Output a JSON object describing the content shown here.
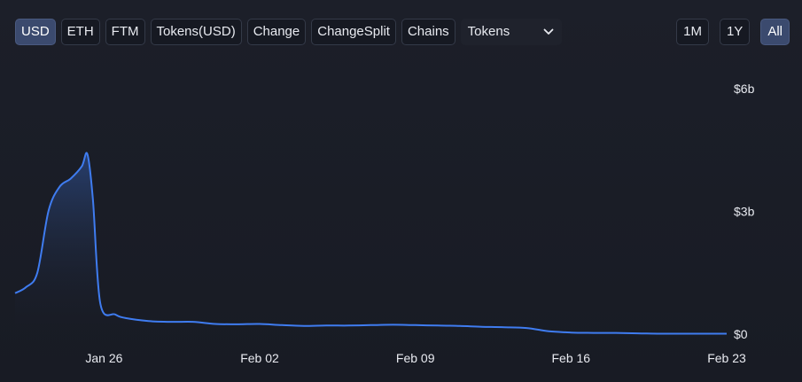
{
  "toolbar": {
    "denominations": [
      {
        "label": "USD",
        "active": true
      },
      {
        "label": "ETH",
        "active": false
      },
      {
        "label": "FTM",
        "active": false
      },
      {
        "label": "Tokens(USD)",
        "active": false
      },
      {
        "label": "Change",
        "active": false
      },
      {
        "label": "ChangeSplit",
        "active": false
      },
      {
        "label": "Chains",
        "active": false
      }
    ],
    "select": {
      "value": "Tokens",
      "icon": "chevron-down-icon"
    }
  },
  "ranges": [
    {
      "label": "1M",
      "active": false
    },
    {
      "label": "1Y",
      "active": false
    },
    {
      "label": "All",
      "active": true
    }
  ],
  "colors": {
    "line": "#3f7cf0",
    "fill_top": "#2c4a86",
    "fill_bottom": "#1a1d26",
    "active_button": "#3b4a6e"
  },
  "chart_data": {
    "type": "area",
    "title": "",
    "xlabel": "",
    "ylabel": "",
    "x_ticks": [
      "Jan 26",
      "Feb 02",
      "Feb 09",
      "Feb 16",
      "Feb 23"
    ],
    "y_ticks": [
      "$0",
      "$3b",
      "$6b"
    ],
    "y_tick_values": [
      0,
      3000000000,
      6000000000
    ],
    "ylim": [
      0,
      6000000000
    ],
    "xlim": [
      "2025-01-22",
      "2025-02-23"
    ],
    "grid": false,
    "series": [
      {
        "values": [
          {
            "x": "2025-01-22",
            "y": 1000000000
          },
          {
            "x": "2025-01-22T12:00",
            "y": 1150000000
          },
          {
            "x": "2025-01-23",
            "y": 1500000000
          },
          {
            "x": "2025-01-23T12:00",
            "y": 3000000000
          },
          {
            "x": "2025-01-24",
            "y": 3600000000
          },
          {
            "x": "2025-01-24T12:00",
            "y": 3800000000
          },
          {
            "x": "2025-01-25",
            "y": 4100000000
          },
          {
            "x": "2025-01-25T06:00",
            "y": 4400000000
          },
          {
            "x": "2025-01-25T12:00",
            "y": 3300000000
          },
          {
            "x": "2025-01-25T20:00",
            "y": 750000000
          },
          {
            "x": "2025-01-26T12:00",
            "y": 480000000
          },
          {
            "x": "2025-01-27",
            "y": 390000000
          },
          {
            "x": "2025-01-28",
            "y": 320000000
          },
          {
            "x": "2025-01-29",
            "y": 300000000
          },
          {
            "x": "2025-01-30",
            "y": 300000000
          },
          {
            "x": "2025-01-31",
            "y": 250000000
          },
          {
            "x": "2025-02-01",
            "y": 240000000
          },
          {
            "x": "2025-02-02",
            "y": 250000000
          },
          {
            "x": "2025-02-03",
            "y": 220000000
          },
          {
            "x": "2025-02-04",
            "y": 200000000
          },
          {
            "x": "2025-02-05",
            "y": 210000000
          },
          {
            "x": "2025-02-06",
            "y": 210000000
          },
          {
            "x": "2025-02-07",
            "y": 220000000
          },
          {
            "x": "2025-02-08",
            "y": 230000000
          },
          {
            "x": "2025-02-09",
            "y": 220000000
          },
          {
            "x": "2025-02-10",
            "y": 210000000
          },
          {
            "x": "2025-02-11",
            "y": 200000000
          },
          {
            "x": "2025-02-12",
            "y": 180000000
          },
          {
            "x": "2025-02-13",
            "y": 170000000
          },
          {
            "x": "2025-02-14",
            "y": 150000000
          },
          {
            "x": "2025-02-15",
            "y": 70000000
          },
          {
            "x": "2025-02-16",
            "y": 40000000
          },
          {
            "x": "2025-02-17",
            "y": 30000000
          },
          {
            "x": "2025-02-18",
            "y": 30000000
          },
          {
            "x": "2025-02-19",
            "y": 20000000
          },
          {
            "x": "2025-02-20",
            "y": 10000000
          },
          {
            "x": "2025-02-21",
            "y": 10000000
          },
          {
            "x": "2025-02-22",
            "y": 10000000
          },
          {
            "x": "2025-02-23",
            "y": 10000000
          }
        ]
      }
    ]
  }
}
